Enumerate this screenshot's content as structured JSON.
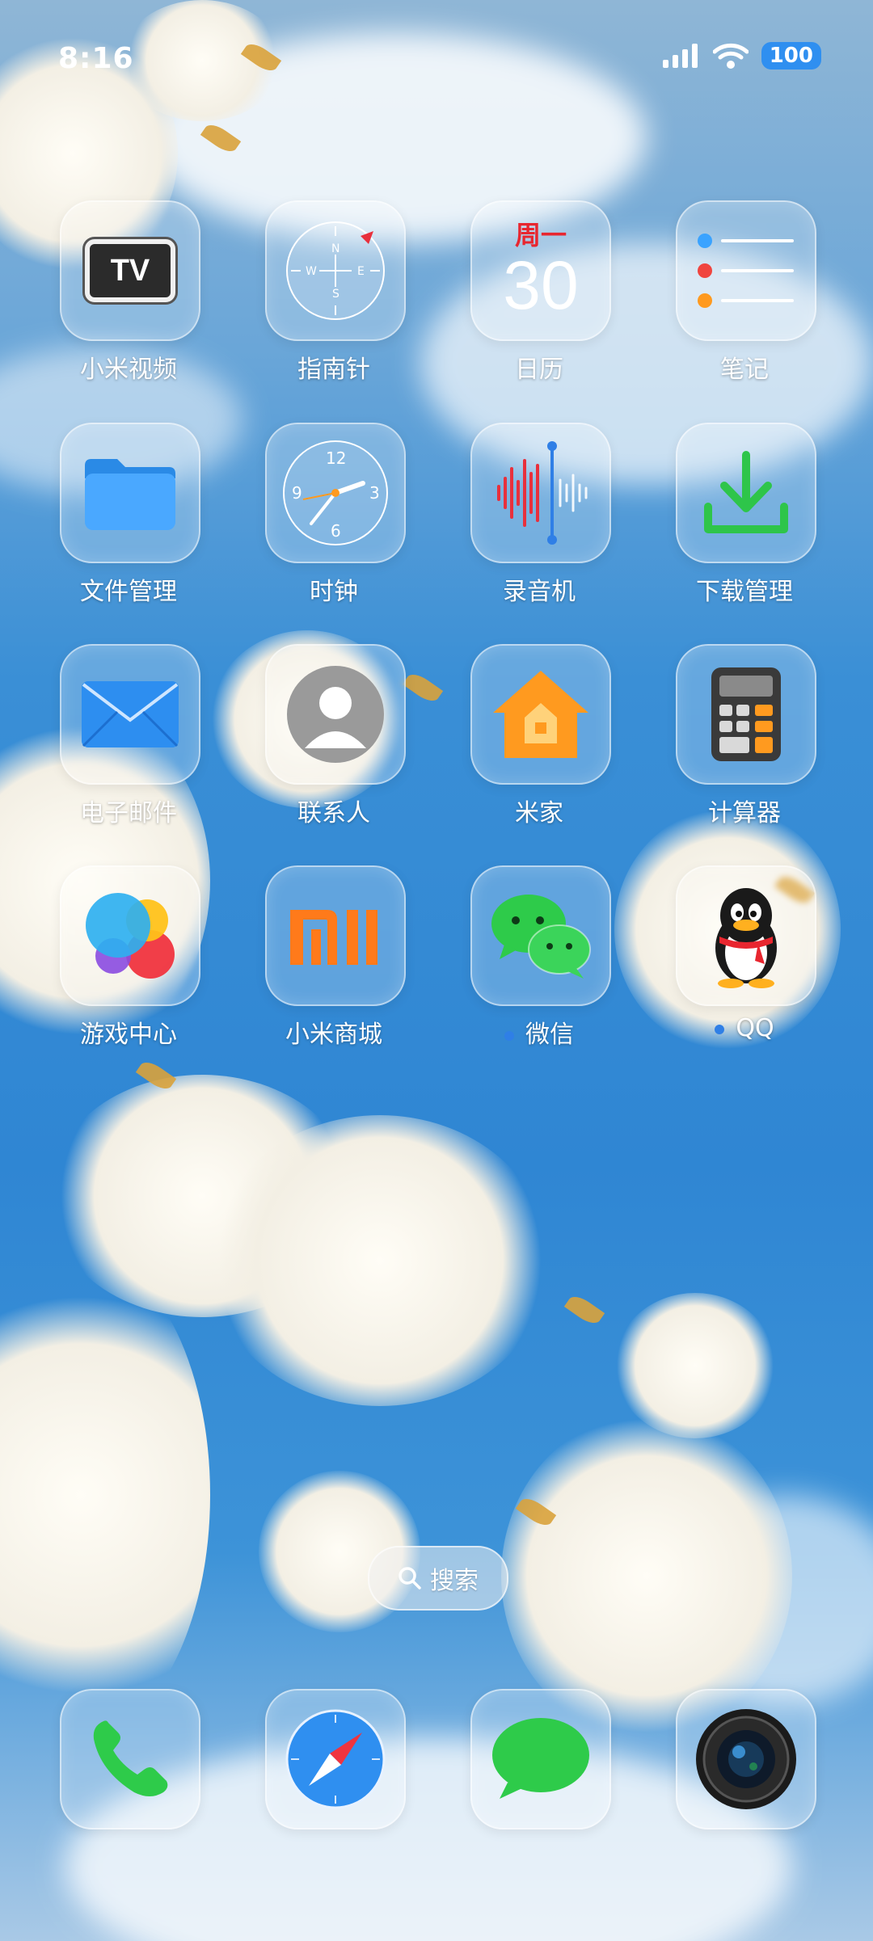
{
  "status_bar": {
    "time": "8:16",
    "battery": "100"
  },
  "apps": [
    {
      "label": "小米视频",
      "icon": "tv-icon",
      "tv_text": "TV"
    },
    {
      "label": "指南针",
      "icon": "compass-icon"
    },
    {
      "label": "日历",
      "icon": "calendar-icon",
      "weekday": "周一",
      "day": "30"
    },
    {
      "label": "笔记",
      "icon": "notes-icon"
    },
    {
      "label": "文件管理",
      "icon": "folder-icon"
    },
    {
      "label": "时钟",
      "icon": "clock-icon"
    },
    {
      "label": "录音机",
      "icon": "waveform-icon"
    },
    {
      "label": "下载管理",
      "icon": "download-icon"
    },
    {
      "label": "电子邮件",
      "icon": "mail-icon"
    },
    {
      "label": "联系人",
      "icon": "contact-icon"
    },
    {
      "label": "米家",
      "icon": "home-icon"
    },
    {
      "label": "计算器",
      "icon": "calculator-icon"
    },
    {
      "label": "游戏中心",
      "icon": "game-center-icon"
    },
    {
      "label": "小米商城",
      "icon": "mi-store-icon",
      "logo_text": "MI"
    },
    {
      "label": "微信",
      "icon": "wechat-icon",
      "has_dot": true
    },
    {
      "label": "QQ",
      "icon": "qq-penguin-icon",
      "has_dot": true
    }
  ],
  "search": {
    "label": "搜索"
  },
  "dock": [
    {
      "name": "phone",
      "icon": "phone-icon"
    },
    {
      "name": "browser",
      "icon": "compass-browser-icon"
    },
    {
      "name": "messages",
      "icon": "message-bubble-icon"
    },
    {
      "name": "camera",
      "icon": "camera-lens-icon"
    }
  ],
  "colors": {
    "accent_blue": "#2f7fe6",
    "notification_dot": "#2f7fe6",
    "battery_bg": "#2f8ff0"
  }
}
